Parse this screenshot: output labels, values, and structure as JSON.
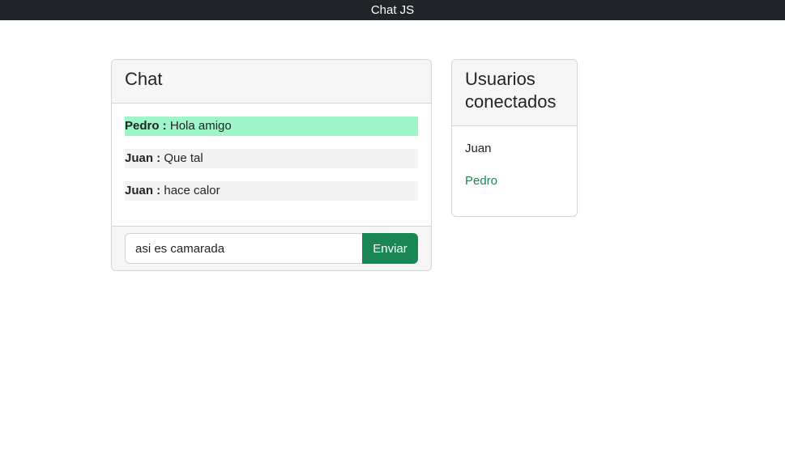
{
  "app": {
    "title": "Chat JS"
  },
  "chat": {
    "header": "Chat",
    "messages": [
      {
        "author": "Pedro :",
        "text": " Hola amigo",
        "own": true
      },
      {
        "author": "Juan :",
        "text": " Que tal",
        "own": false
      },
      {
        "author": "Juan :",
        "text": " hace calor",
        "own": false
      }
    ],
    "input_value": "asi es camarada",
    "send_label": "Enviar"
  },
  "users": {
    "header": "Usuarios conectados",
    "list": [
      {
        "name": "Juan",
        "self": false
      },
      {
        "name": "Pedro",
        "self": true
      }
    ]
  },
  "colors": {
    "navbar": "#212529",
    "own_message_bg": "#9df5c8",
    "other_message_bg": "#f3f3f4",
    "accent_green": "#198754"
  }
}
